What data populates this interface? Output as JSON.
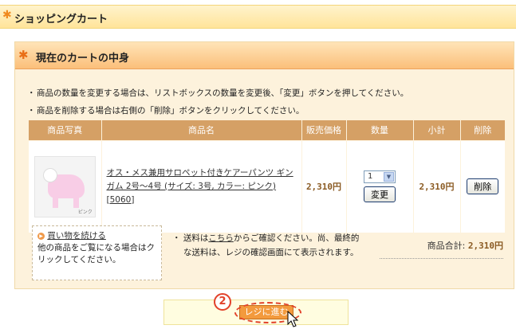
{
  "header": {
    "title": "ショッピングカート"
  },
  "cart": {
    "heading": "現在のカートの中身",
    "instructions": [
      "商品の数量を変更する場合は、リストボックスの数量を変更後、「変更」ボタンを押してください。",
      "商品を削除する場合は右側の「削除」ボタンをクリックしてください。"
    ],
    "columns": [
      "商品写真",
      "商品名",
      "販売価格",
      "数量",
      "小計",
      "削除"
    ],
    "item": {
      "name": "オス・メス兼用サロペット付きケアーパンツ ギンガム 2号〜4号 (サイズ: 3号, カラー: ピンク)[5060]",
      "price": "2,310円",
      "quantity": "1",
      "update_label": "変更",
      "subtotal": "2,310円",
      "delete_label": "削除",
      "photo_tag": "ピンク"
    },
    "continue": {
      "link": "買い物を続ける",
      "text": "他の商品をご覧になる場合はクリックしてください。"
    },
    "shipping": {
      "prefix": "送料は",
      "link": "こちら",
      "suffix": "からご確認ください。尚、最終的",
      "line2": "な送料は、レジの確認画面にて表示されます。"
    },
    "total": {
      "label": "商品合計:",
      "value": "2,310円"
    }
  },
  "checkout": {
    "label": "レジに進む",
    "step": "2"
  },
  "colors": {
    "accent": "#f39a3d",
    "table_header": "#d5a065",
    "highlight": "#e2422b"
  }
}
